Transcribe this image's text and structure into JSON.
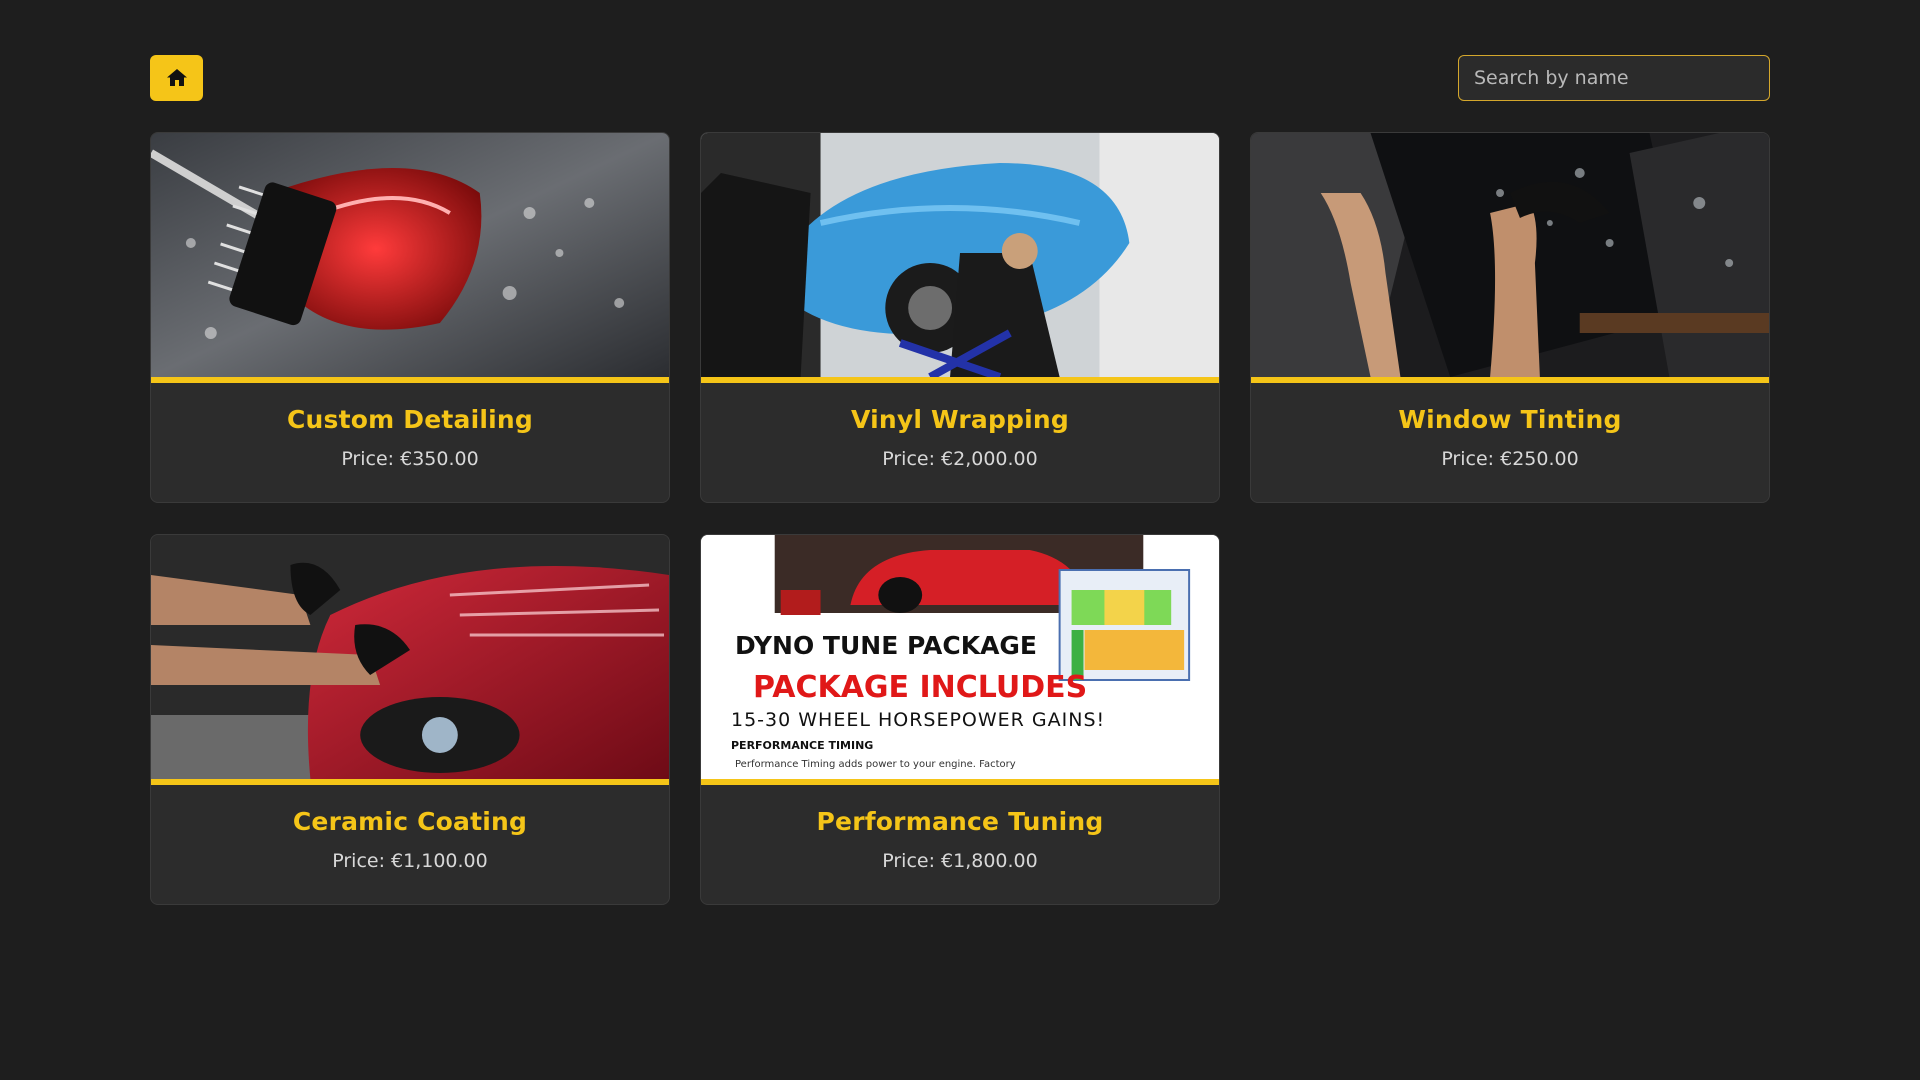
{
  "header": {
    "home_icon": "home-icon",
    "search_placeholder": "Search by name"
  },
  "colors": {
    "accent": "#f5c518",
    "background": "#1e1e1e",
    "card_background": "#2c2c2c"
  },
  "services": [
    {
      "title": "Custom Detailing",
      "price": "Price: €350.00"
    },
    {
      "title": "Vinyl Wrapping",
      "price": "Price: €2,000.00"
    },
    {
      "title": "Window Tinting",
      "price": "Price: €250.00"
    },
    {
      "title": "Ceramic Coating",
      "price": "Price: €1,100.00"
    },
    {
      "title": "Performance Tuning",
      "price": "Price: €1,800.00"
    }
  ],
  "dyno_image": {
    "line1": "DYNO TUNE PACKAGE",
    "line2": "PACKAGE INCLUDES",
    "line3": "15-30 WHEEL HORSEPOWER GAINS!",
    "line4": "PERFORMANCE TIMING",
    "line5": "Performance Timing adds power to your engine. Factory"
  }
}
